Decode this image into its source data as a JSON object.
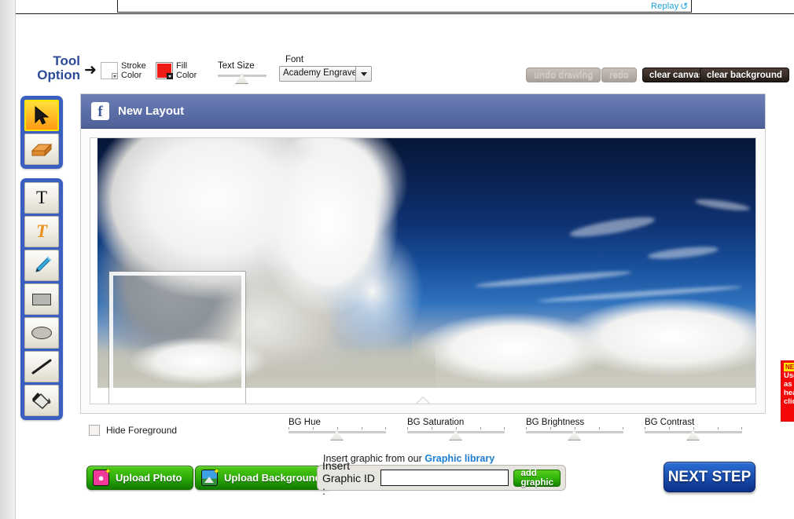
{
  "top_panel": {
    "replay_label": "Replay",
    "replay_icon": "refresh-icon"
  },
  "tool_option": {
    "title_line1": "Tool",
    "title_line2": "Option",
    "arrow_icon": "right-arrow-icon",
    "stroke": {
      "label_line1": "Stroke",
      "label_line2": "Color",
      "color": "#ffffff",
      "icon": "stroke-color-swatch"
    },
    "fill": {
      "label_line1": "Fill",
      "label_line2": "Color",
      "color": "#ee1b17",
      "icon": "fill-color-swatch"
    },
    "text_size": {
      "label": "Text Size",
      "value": 35
    },
    "font": {
      "label": "Font",
      "value": "Academy Engrave"
    },
    "buttons": {
      "undo": "undo drawing",
      "redo": "redo",
      "clear_canvas": "clear canvas",
      "clear_background": "clear background"
    }
  },
  "palette": {
    "group1": [
      {
        "name": "tool-select-arrow",
        "icon": "cursor-arrow-icon",
        "active": true
      },
      {
        "name": "tool-eraser",
        "icon": "eraser-icon",
        "active": false
      }
    ],
    "group2": [
      {
        "name": "tool-text",
        "icon": "text-T-icon",
        "active": false
      },
      {
        "name": "tool-styled-text",
        "icon": "styled-text-T-icon",
        "active": false
      },
      {
        "name": "tool-pen",
        "icon": "pen-icon",
        "active": false
      },
      {
        "name": "tool-rectangle",
        "icon": "rectangle-shape-icon",
        "active": false
      },
      {
        "name": "tool-ellipse",
        "icon": "ellipse-shape-icon",
        "active": false
      },
      {
        "name": "tool-line",
        "icon": "line-shape-icon",
        "active": false
      },
      {
        "name": "tool-paint-bucket",
        "icon": "paint-bucket-icon",
        "active": false
      }
    ]
  },
  "editor": {
    "brand_icon": "facebook-icon",
    "brand_letter": "f",
    "title": "New Layout",
    "canvas": {
      "alt": "cloud-sky-photo",
      "selection": "selection-rectangle"
    }
  },
  "adjustments": {
    "hide_foreground": {
      "label": "Hide Foreground",
      "checked": false
    },
    "sliders": [
      {
        "label": "BG Hue",
        "value": 50
      },
      {
        "label": "BG Saturation",
        "value": 50
      },
      {
        "label": "BG Brightness",
        "value": 50
      },
      {
        "label": "BG Contrast",
        "value": 50
      }
    ]
  },
  "bottom": {
    "upload_photo": {
      "label": "Upload  Photo",
      "icon": "person-photo-icon"
    },
    "upload_background": {
      "label": "Upload Background",
      "icon": "landscape-image-icon"
    },
    "graphic_caption_prefix": "Insert graphic from our ",
    "graphic_library_link": "Graphic library",
    "graphic_id_label": "Insert Graphic ID :",
    "graphic_id_value": "",
    "graphic_id_placeholder": "",
    "add_graphic_label": "add graphic",
    "next_step_label": "NEXT STEP"
  },
  "notice": {
    "badge": "NEW",
    "line1": "Use",
    "line2": "as",
    "line3": "hea",
    "line4": "clic"
  },
  "colors": {
    "brand_blue": "#3b5fc0",
    "header_blue": "#5b6da6",
    "accent_green": "#2fae09",
    "next_blue": "#1b52b4",
    "notice_red": "#f60808",
    "link_blue": "#1a7ed4"
  }
}
